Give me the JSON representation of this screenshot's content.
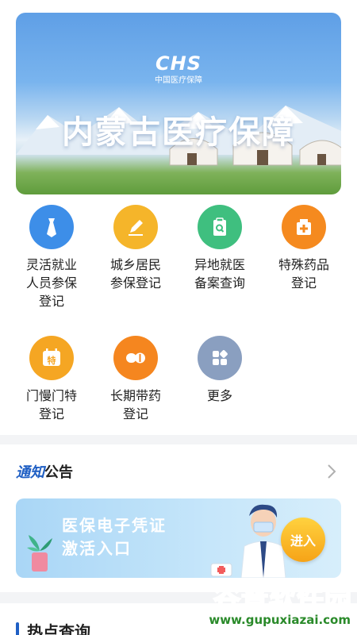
{
  "banner": {
    "logo": "CHS",
    "logo_sub": "中国医疗保障",
    "title": "内蒙古医疗保障"
  },
  "services": [
    {
      "label": "灵活就业\n人员参保\n登记",
      "icon": "tie-icon",
      "color": "#3d8ee8"
    },
    {
      "label": "城乡居民\n参保登记",
      "icon": "edit-icon",
      "color": "#f5b52a"
    },
    {
      "label": "异地就医\n备案查询",
      "icon": "clipboard-search-icon",
      "color": "#3fbf7f"
    },
    {
      "label": "特殊药品\n登记",
      "icon": "medicine-box-icon",
      "color": "#f58a1f"
    },
    {
      "label": "门慢门特\n登记",
      "icon": "calendar-special-icon",
      "color": "#f5a623",
      "badge": "特"
    },
    {
      "label": "长期带药\n登记",
      "icon": "pill-icon",
      "color": "#f5861f"
    },
    {
      "label": "更多",
      "icon": "more-grid-icon",
      "color": "#8a9fc0"
    }
  ],
  "notice": {
    "title_part1": "通知",
    "title_part2": "公告",
    "promo_line1": "医保电子凭证",
    "promo_line2": "激活入口",
    "promo_button": "进入"
  },
  "hot": {
    "title": "热点查询"
  },
  "watermark": {
    "main": "谷普软件园",
    "url": "www.gupuxiazai.com"
  }
}
